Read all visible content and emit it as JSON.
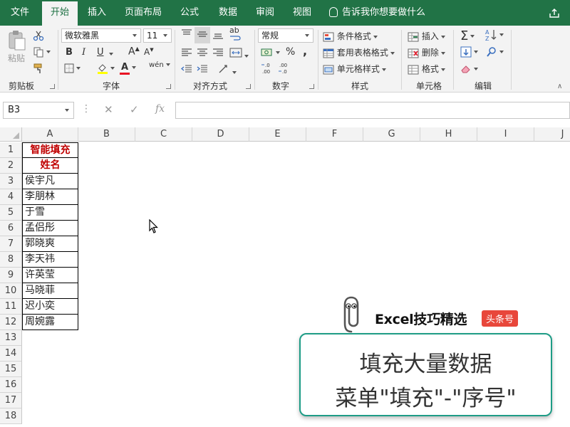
{
  "tabs": [
    {
      "label": "文件",
      "active": false
    },
    {
      "label": "开始",
      "active": true
    },
    {
      "label": "插入",
      "active": false
    },
    {
      "label": "页面布局",
      "active": false
    },
    {
      "label": "公式",
      "active": false
    },
    {
      "label": "数据",
      "active": false
    },
    {
      "label": "审阅",
      "active": false
    },
    {
      "label": "视图",
      "active": false
    }
  ],
  "tell_me": "告诉我你想要做什么",
  "share_label": "共",
  "ribbon": {
    "clipboard": {
      "paste": "粘贴",
      "label": "剪贴板"
    },
    "font": {
      "name": "微软雅黑",
      "size": "11",
      "bold": "B",
      "italic": "I",
      "underline": "U",
      "grow": "A",
      "shrink": "A",
      "font_color": "A",
      "phonetic": "wén",
      "label": "字体"
    },
    "alignment": {
      "wrap": "ab",
      "label": "对齐方式"
    },
    "number": {
      "format": "常规",
      "percent": "%",
      "comma": ",",
      "label": "数字"
    },
    "styles": {
      "conditional": "条件格式",
      "table": "套用表格格式",
      "cell_styles": "单元格样式",
      "label": "样式"
    },
    "cells": {
      "insert": "插入",
      "delete": "删除",
      "format": "格式",
      "label": "单元格"
    },
    "editing": {
      "label": "编辑"
    }
  },
  "name_box": "B3",
  "fx_label": "fx",
  "columns": [
    "A",
    "B",
    "C",
    "D",
    "E",
    "F",
    "G",
    "H",
    "I",
    "J"
  ],
  "rows": [
    "1",
    "2",
    "3",
    "4",
    "5",
    "6",
    "7",
    "8",
    "9",
    "10",
    "11",
    "12",
    "13",
    "14",
    "15",
    "16",
    "17",
    "18"
  ],
  "cells_A": [
    "智能填充",
    "姓名",
    "侯宇凡",
    "李朋林",
    "于雪",
    "孟侣彤",
    "郭晓爽",
    "李天祎",
    "许英莹",
    "马晓菲",
    "迟小奕",
    "周婉露"
  ],
  "brand": {
    "name": "Excel技巧精选",
    "tag": "头条号"
  },
  "caption": {
    "line1": "填充大量数据",
    "line2": "菜单\"填充\"-\"序号\""
  },
  "colors": {
    "excel_green": "#217346",
    "header_red": "#c00000",
    "caption_border": "#1e9c86",
    "tag_red": "#e8473b"
  }
}
